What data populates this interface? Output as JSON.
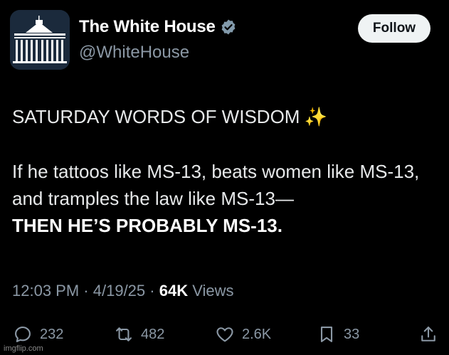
{
  "account": {
    "display_name": "The White House",
    "handle": "@WhiteHouse",
    "verified_icon": "verified-badge-icon",
    "follow_label": "Follow"
  },
  "tweet": {
    "heading": "SATURDAY WORDS OF WISDOM",
    "heading_emoji": "✨",
    "body": "If he tattoos like MS-13, beats women like MS-13, and tramples the law like MS-13—",
    "emphasis": "THEN HE’S PROBABLY MS-13."
  },
  "meta": {
    "time": "12:03 PM",
    "date": "4/19/25",
    "views_count": "64K",
    "views_label": "Views"
  },
  "actions": {
    "replies": "232",
    "reposts": "482",
    "likes": "2.6K",
    "bookmarks": "33"
  },
  "watermark": "imgflip.com",
  "colors": {
    "background": "#000000",
    "text": "#e7e9ea",
    "secondary": "#8b98a5",
    "verified": "#829aab",
    "follow_bg": "#eff3f4"
  }
}
